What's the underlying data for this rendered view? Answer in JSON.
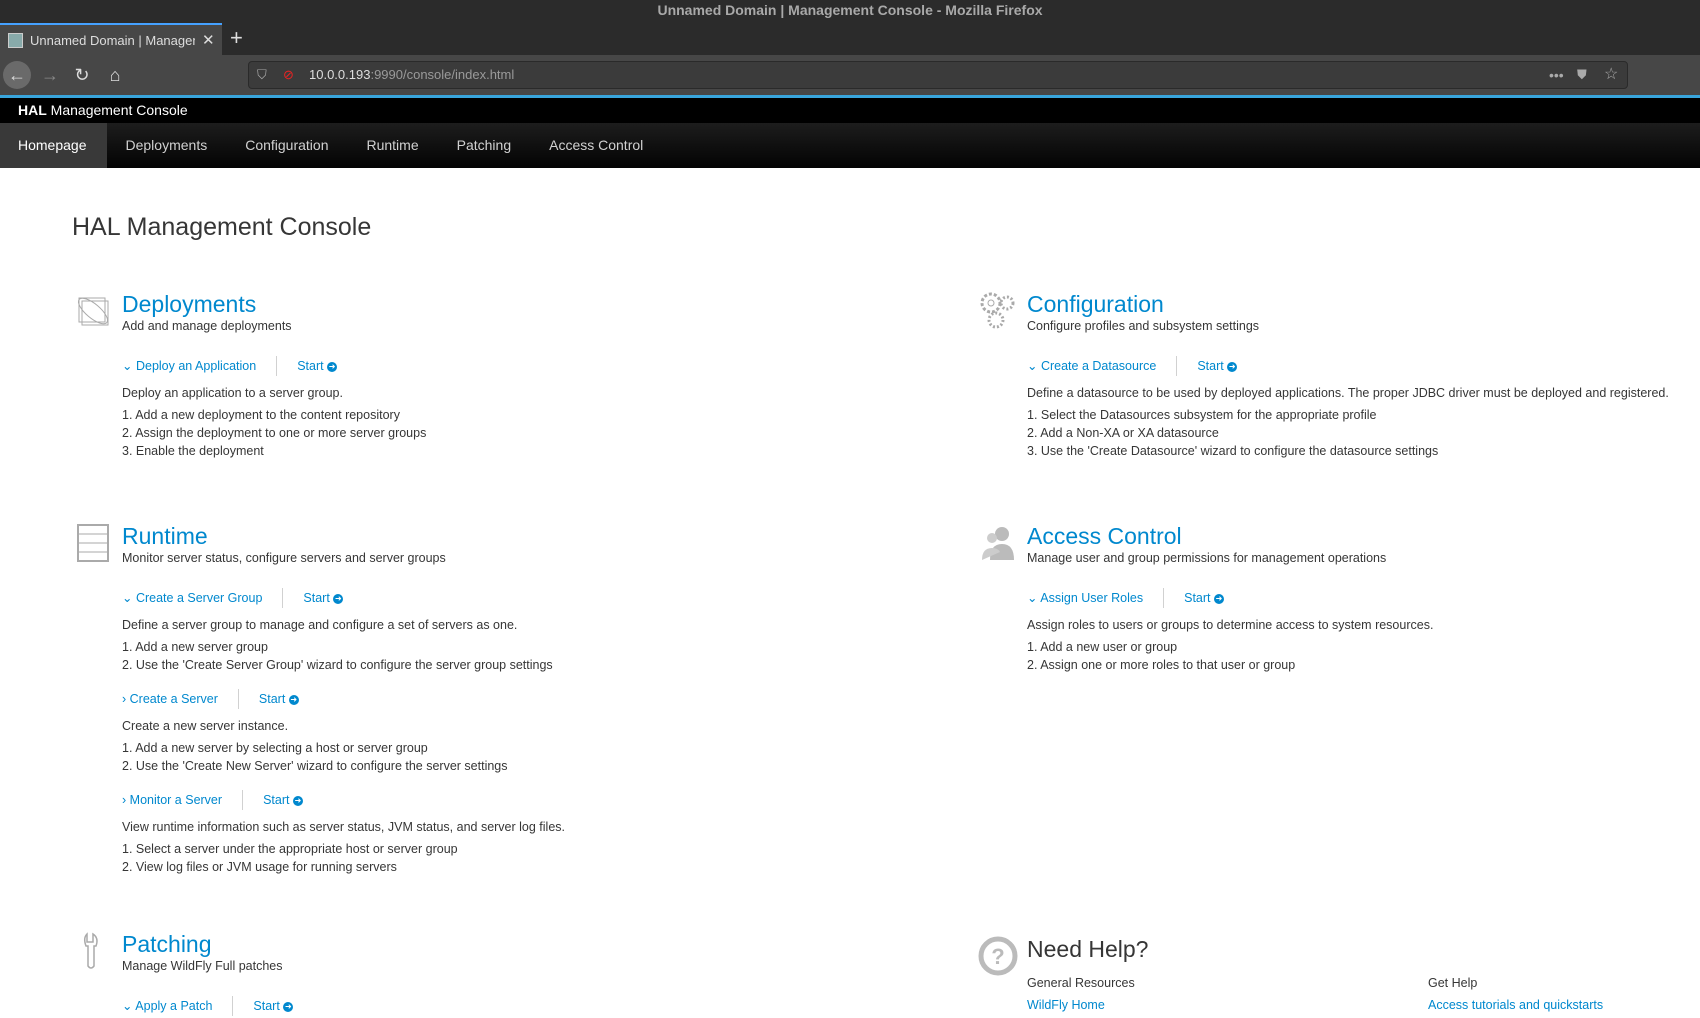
{
  "browser": {
    "window_title": "Unnamed Domain | Management Console - Mozilla Firefox",
    "tab_label": "Unnamed Domain | Management Console",
    "url_host": "10.0.0.193",
    "url_rest": ":9990/console/index.html"
  },
  "app": {
    "brand_bold": "HAL",
    "brand_rest": " Management Console"
  },
  "nav": [
    "Homepage",
    "Deployments",
    "Configuration",
    "Runtime",
    "Patching",
    "Access Control"
  ],
  "page_title": "HAL Management Console",
  "start_label": "Start",
  "deployments": {
    "title": "Deployments",
    "subtitle": "Add and manage deployments",
    "tasks": [
      {
        "label": "Deploy an Application",
        "desc": "Deploy an application to a server group.",
        "steps": [
          "1. Add a new deployment to the content repository",
          "2. Assign the deployment to one or more server groups",
          "3. Enable the deployment"
        ]
      }
    ]
  },
  "configuration": {
    "title": "Configuration",
    "subtitle": "Configure profiles and subsystem settings",
    "tasks": [
      {
        "label": "Create a Datasource",
        "desc": "Define a datasource to be used by deployed applications. The proper JDBC driver must be deployed and registered.",
        "steps": [
          "1. Select the Datasources subsystem for the appropriate profile",
          "2. Add a Non-XA or XA datasource",
          "3. Use the 'Create Datasource' wizard to configure the datasource settings"
        ]
      }
    ]
  },
  "runtime": {
    "title": "Runtime",
    "subtitle": "Monitor server status, configure servers and server groups",
    "tasks": [
      {
        "label": "Create a Server Group",
        "desc": "Define a server group to manage and configure a set of servers as one.",
        "steps": [
          "1. Add a new server group",
          "2. Use the 'Create Server Group' wizard to configure the server group settings"
        ]
      },
      {
        "label": "Create a Server",
        "desc": "Create a new server instance.",
        "steps": [
          "1. Add a new server by selecting a host or server group",
          "2. Use the 'Create New Server' wizard to configure the server settings"
        ]
      },
      {
        "label": "Monitor a Server",
        "desc": "View runtime information such as server status, JVM status, and server log files.",
        "steps": [
          "1. Select a server under the appropriate host or server group",
          "2. View log files or JVM usage for running servers"
        ]
      }
    ]
  },
  "access": {
    "title": "Access Control",
    "subtitle": "Manage user and group permissions for management operations",
    "tasks": [
      {
        "label": "Assign User Roles",
        "desc": "Assign roles to users or groups to determine access to system resources.",
        "steps": [
          "1. Add a new user or group",
          "2. Assign one or more roles to that user or group"
        ]
      }
    ]
  },
  "patching": {
    "title": "Patching",
    "subtitle": "Manage WildFly Full patches",
    "tasks": [
      {
        "label": "Apply a Patch"
      }
    ]
  },
  "help": {
    "title": "Need Help?",
    "general": "General Resources",
    "general_link": "WildFly Home",
    "get": "Get Help",
    "get_link": "Access tutorials and quickstarts"
  }
}
